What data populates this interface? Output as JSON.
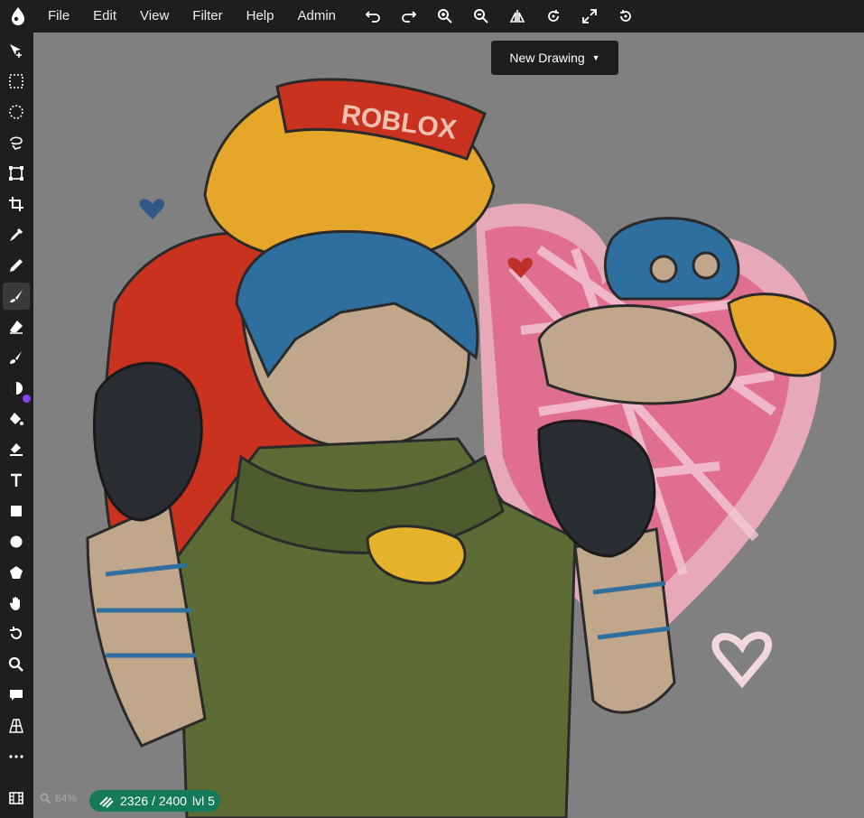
{
  "menu": [
    "File",
    "Edit",
    "View",
    "Filter",
    "Help",
    "Admin"
  ],
  "toolbar_top_icons": [
    "undo-icon",
    "redo-icon",
    "zoom-in-icon",
    "zoom-out-icon",
    "flip-icon",
    "rotate-icon",
    "fullscreen-icon",
    "reset-rotate-icon"
  ],
  "tools": [
    "move-tool-icon",
    "rect-select-icon",
    "ellipse-select-icon",
    "lasso-icon",
    "transform-icon",
    "crop-icon",
    "eyedropper-icon",
    "pen-icon",
    "brush-icon",
    "eraser-icon",
    "smudge-icon",
    "blend-icon",
    "fill-icon",
    "gradient-icon",
    "text-icon",
    "rectangle-icon",
    "ellipse-icon",
    "shape-icon",
    "hand-icon",
    "rotate-view-icon",
    "zoom-tool-icon",
    "comment-icon",
    "perspective-icon",
    "more-icon",
    "filmstrip-icon"
  ],
  "new_drawing_label": "New Drawing",
  "zoom_label": "84%",
  "level": {
    "progress": "2326 / 2400",
    "label": "lvl 5"
  },
  "colors": {
    "bar": "#1e1e1e",
    "canvas": "#808080",
    "pill": "#157a5a",
    "badge": "#8a3ffc"
  }
}
